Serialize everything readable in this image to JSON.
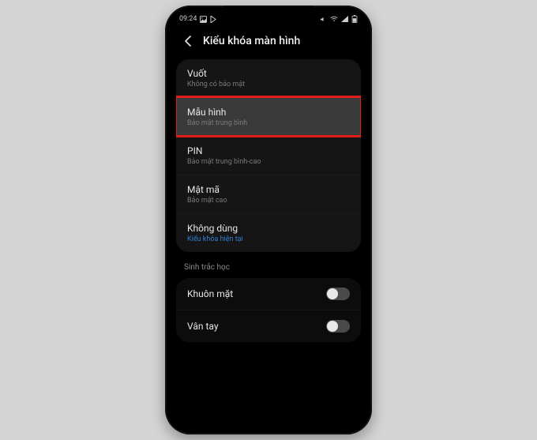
{
  "status": {
    "time": "09:24",
    "left_icons": [
      "image-icon",
      "play-icon"
    ],
    "right_icons": [
      "volume-icon",
      "wifi-icon",
      "signal-icon",
      "battery-icon"
    ]
  },
  "header": {
    "title": "Kiểu khóa màn hình"
  },
  "lock_options": [
    {
      "title": "Vuốt",
      "subtitle": "Không có bảo mật",
      "highlighted": false,
      "sub_blue": false
    },
    {
      "title": "Mẫu hình",
      "subtitle": "Bảo mật trung bình",
      "highlighted": true,
      "sub_blue": false
    },
    {
      "title": "PIN",
      "subtitle": "Bảo mật trung bình-cao",
      "highlighted": false,
      "sub_blue": false
    },
    {
      "title": "Mật mã",
      "subtitle": "Bảo mật cao",
      "highlighted": false,
      "sub_blue": false
    },
    {
      "title": "Không dùng",
      "subtitle": "Kiểu khóa hiện tại",
      "highlighted": false,
      "sub_blue": true
    }
  ],
  "biometric": {
    "section_label": "Sinh trắc học",
    "items": [
      {
        "label": "Khuôn mặt",
        "on": false
      },
      {
        "label": "Vân tay",
        "on": false
      }
    ]
  }
}
